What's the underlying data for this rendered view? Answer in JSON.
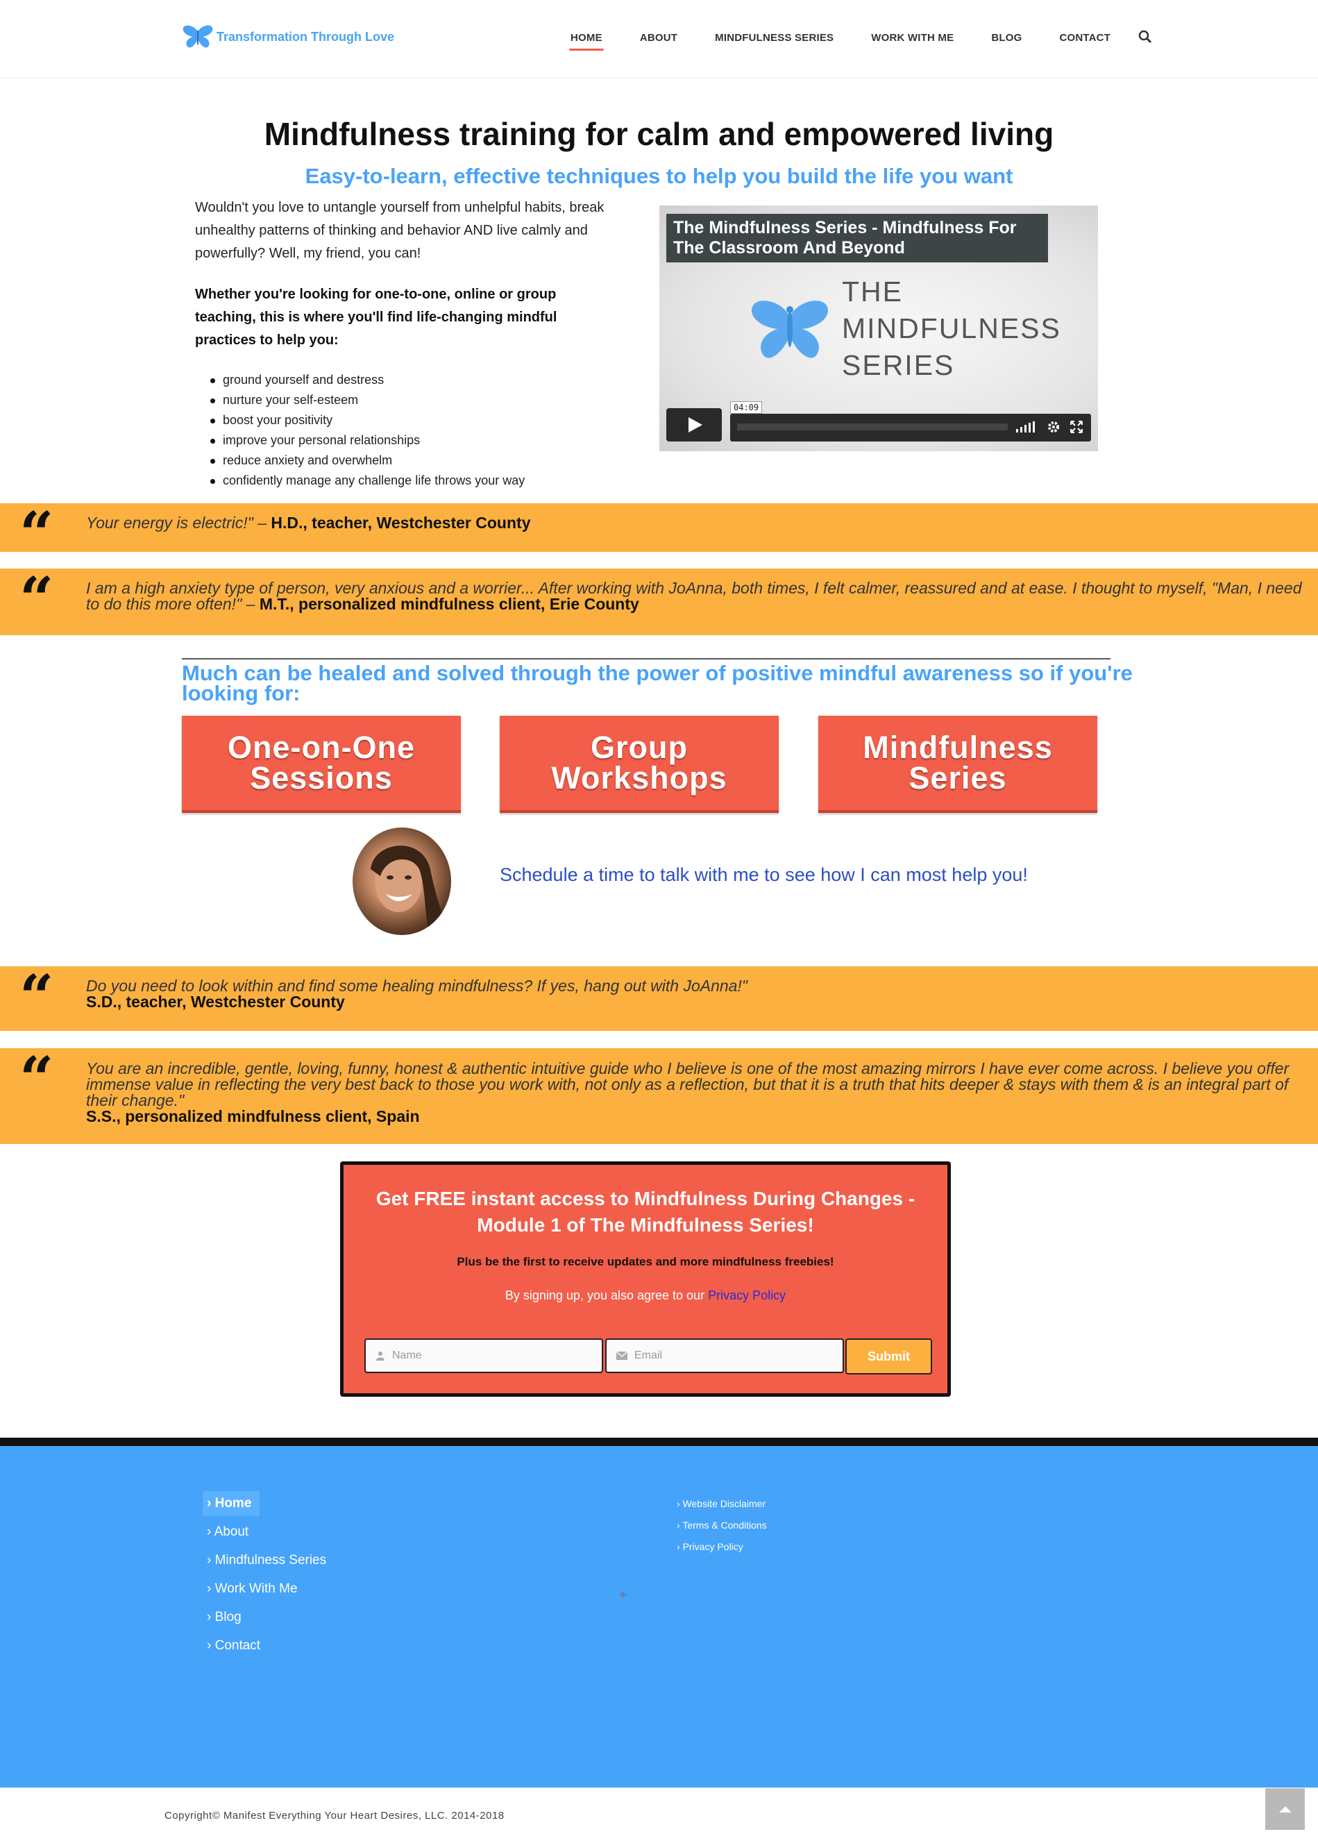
{
  "header": {
    "logo_text": "Transformation Through Love",
    "nav": [
      "HOME",
      "ABOUT",
      "MINDFULNESS SERIES",
      "WORK WITH ME",
      "BLOG",
      "CONTACT"
    ],
    "active_nav": "HOME",
    "search_icon": "search-icon"
  },
  "hero": {
    "title": "Mindfulness training for calm and empowered living",
    "subtitle": "Easy-to-learn, effective techniques to help you build the life you want",
    "intro": "Wouldn't you love to untangle yourself from unhelpful habits, break unhealthy patterns of thinking and behavior AND live calmly and powerfully? Well, my friend, you can!",
    "intro_bold": "Whether you're looking for one-to-one, online or group teaching, this is where you'll find life-changing mindful practices to help you:",
    "bullets": [
      "ground yourself and destress",
      "nurture your self-esteem",
      "boost your positivity",
      "improve your personal relationships",
      "reduce anxiety and overwhelm",
      "confidently manage any challenge life throws your way"
    ]
  },
  "video": {
    "title": "The Mindfulness Series - Mindfulness For The Classroom And Beyond",
    "brand_line1": "THE",
    "brand_line2": "MINDFULNESS",
    "brand_line3": "SERIES",
    "duration": "04:09",
    "accent_color": "#4aa3f7"
  },
  "testimonials": [
    {
      "text": "Your energy is electric!\" –",
      "author": "H.D., teacher, Westchester County"
    },
    {
      "text": "I am a high anxiety type of person, very anxious and a worrier... After working with JoAnna, both times, I felt calmer, reassured and at ease. I thought to myself, \"Man, I need to do this more often!\" –",
      "author": "M.T., personalized mindfulness client, Erie County"
    },
    {
      "text": "Do you need to look within and find some healing mindfulness? If yes, hang out with JoAnna!\"",
      "author": "S.D., teacher, Westchester County"
    },
    {
      "text": "You are an incredible, gentle, loving, funny, honest & authentic intuitive guide who I believe is one of the most amazing mirrors I have ever come across. I believe you offer immense value in reflecting the very best back to those you work with, not only as a reflection, but that it is a truth that hits deeper & stays with them & is an integral part of their change.\"",
      "author": "S.S., personalized mindfulness client, Spain"
    }
  ],
  "services": {
    "headline": "Much can be healed and solved through the power of positive mindful awareness so if you're looking for:",
    "buttons": [
      {
        "line1": "One-on-One",
        "line2": "Sessions"
      },
      {
        "line1": "Group",
        "line2": "Workshops"
      },
      {
        "line1": "Mindfulness",
        "line2": "Series"
      }
    ],
    "schedule_text": "Schedule a time to talk with me to see how I can most help you!"
  },
  "optin": {
    "title": "Get FREE instant access to Mindfulness During Changes - Module 1 of The Mindfulness Series!",
    "subtitle": "Plus be the first to receive updates and more mindfulness freebies!",
    "policy_prefix": "By signing up, you also agree to our",
    "policy_link": "Privacy Policy",
    "name_placeholder": "Name",
    "email_placeholder": "Email",
    "submit_label": "Submit"
  },
  "footer": {
    "menu": [
      "Home",
      "About",
      "Mindfulness Series",
      "Work With Me",
      "Blog",
      "Contact"
    ],
    "legal": [
      "Website Disclaimer",
      "Terms & Conditions",
      "Privacy Policy"
    ],
    "copyright": "Copyright© Manifest Everything Your Heart Desires, LLC. 2014-2018",
    "background_color": "#45a3fa"
  },
  "colors": {
    "brand_blue": "#4aa3f7",
    "cta_red": "#f25e4a",
    "quote_orange": "#fbb040"
  }
}
